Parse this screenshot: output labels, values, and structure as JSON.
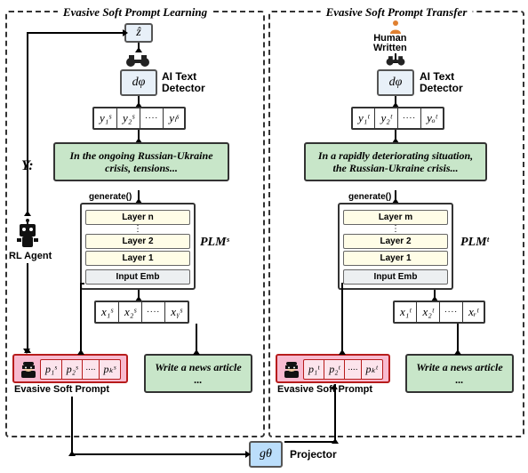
{
  "left_panel": {
    "title": "Evasive Soft Prompt Learning",
    "zhat": "ẑ",
    "detector": {
      "symbol": "dφ",
      "label": "AI Text\nDetector"
    },
    "y_seq": [
      "y₁ˢ",
      "y₂ˢ",
      "yₗˢ"
    ],
    "generated_text": "In the ongoing Russian-Ukraine crisis, tensions...",
    "y_label": "Y:",
    "generate_label": "generate()",
    "plm": {
      "layers": [
        "Layer n",
        "Layer 2",
        "Layer 1"
      ],
      "emb": "Input Emb",
      "label": "PLMˢ"
    },
    "x_seq": [
      "x₁ˢ",
      "x₂ˢ",
      "x ᵧˢ"
    ],
    "soft_prompt": {
      "tokens": [
        "p₁ˢ",
        "p₂ˢ",
        "pₖˢ"
      ],
      "label": "Evasive Soft Prompt"
    },
    "input_prompt": "Write a news article ...",
    "agent_label": "RL Agent"
  },
  "right_panel": {
    "title": "Evasive Soft Prompt Transfer",
    "human_label": "Human\nWritten",
    "detector": {
      "symbol": "dφ",
      "label": "AI Text\nDetector"
    },
    "y_seq": [
      "y₁ᵗ",
      "y₂ᵗ",
      "yₒᵗ"
    ],
    "generated_text": "In a rapidly deteriorating situation, the Russian-Ukraine crisis...",
    "generate_label": "generate()",
    "plm": {
      "layers": [
        "Layer m",
        "Layer 2",
        "Layer 1"
      ],
      "emb": "Input Emb",
      "label": "PLMᵗ"
    },
    "x_seq": [
      "x₁ᵗ",
      "x₂ᵗ",
      "xᵣᵗ"
    ],
    "soft_prompt": {
      "tokens": [
        "p₁ᵗ",
        "p₂ᵗ",
        "pₖᵗ"
      ],
      "label": "Evasive Soft Prompt"
    },
    "input_prompt": "Write a news article ..."
  },
  "projector": {
    "symbol": "gθ",
    "label": "Projector"
  }
}
